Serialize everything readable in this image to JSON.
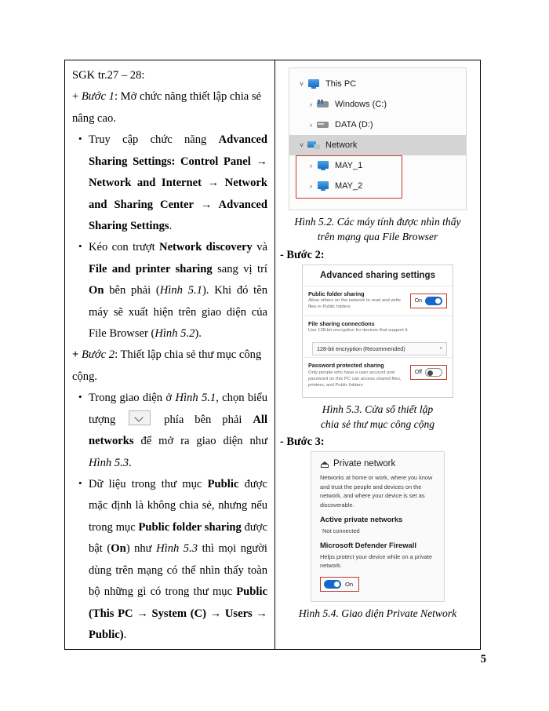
{
  "page": {
    "number": "5"
  },
  "left_column": {
    "source_ref": "SGK tr.27 – 28:",
    "step1_intro_prefix": "+ ",
    "step1_label": "Bước 1",
    "step1_text": ": Mở chức năng thiết lập chia sẻ nâng cao.",
    "bullets": [
      {
        "id": "bullet-advanced-sharing",
        "plain_1": "Truy cập chức năng ",
        "bold_1": "Advanced Sharing Settings: Control Panel → Network and Internet → Network and Sharing Center → Advanced Sharing Settings",
        "plain_2": "."
      },
      {
        "id": "bullet-network-discovery",
        "plain_1": "Kéo con trượt ",
        "bold_1": "Network discovery",
        "plain_2": " và ",
        "bold_2": "File and printer sharing",
        "plain_3": " sang vị trí ",
        "bold_3": "On",
        "plain_4": " bên phải (",
        "italic_1": "Hình 5.1",
        "plain_5": "). Khi đó tên máy sẽ xuất hiện trên giao diện của File Browser (",
        "italic_2": "Hình 5.2",
        "plain_6": ")."
      }
    ],
    "step2_intro_prefix": "+ ",
    "step2_label": "Bước 2",
    "step2_text": ": Thiết lập chia sẻ thư mục công cộng.",
    "bullets2": [
      {
        "id": "bullet-all-networks",
        "plain_1": "Trong giao diện ở ",
        "italic_1": "Hình 5.1",
        "plain_2": ", chọn biểu tượng ",
        "icon": "chevron-down-icon",
        "plain_3": " phía bên phải ",
        "bold_1": "All networks",
        "plain_4": " để mở ra giao diện như ",
        "italic_2": "Hình 5.3",
        "plain_5": "."
      },
      {
        "id": "bullet-public-folder",
        "plain_1": "Dữ liệu trong thư mục ",
        "bold_1": "Public",
        "plain_2": " được mặc định là không chia sẻ, nhưng nếu trong mục ",
        "bold_2": "Public folder sharing",
        "plain_3": " được bật (",
        "bold_3": "On",
        "plain_4": ") như ",
        "italic_1": "Hình 5.3",
        "plain_5": " thì mọi người dùng trên mạng có thể nhìn thấy toàn bộ những gì có trong thư mục ",
        "bold_4": "Public (This PC → System (C) → Users → Public)",
        "plain_6": "."
      }
    ]
  },
  "right_column": {
    "figure_52": {
      "caption_line1": "Hình 5.2. Các máy tính được nhìn thấy",
      "caption_line2": "trên mạng qua File Browser",
      "tree": [
        {
          "label": "This PC",
          "caret": "˅",
          "icon": "monitor-icon",
          "indent": 0,
          "selected": false
        },
        {
          "label": "Windows (C:)",
          "caret": "›",
          "icon": "drive-windows-icon",
          "indent": 1,
          "selected": false
        },
        {
          "label": "DATA (D:)",
          "caret": "›",
          "icon": "drive-icon",
          "indent": 1,
          "selected": false
        },
        {
          "label": "Network",
          "caret": "˅",
          "icon": "network-icon",
          "indent": 0,
          "selected": true
        },
        {
          "label": "MAY_1",
          "caret": "›",
          "icon": "monitor-icon",
          "indent": 1,
          "selected": false
        },
        {
          "label": "MAY_2",
          "caret": "›",
          "icon": "monitor-icon",
          "indent": 1,
          "selected": false
        }
      ],
      "highlight_color": "#c0392b"
    },
    "step2_heading": "- Bước 2:",
    "figure_53": {
      "caption_line1": "Hình 5.3. Cửa sổ thiết lập",
      "caption_line2": "chia sẻ thư mục công cộng",
      "panel_title": "Advanced sharing settings",
      "sections": [
        {
          "id": "public-folder-sharing",
          "heading": "Public folder sharing",
          "description": "Allow others on the network to  read and write files in Public folders",
          "toggle_label": "On",
          "toggle_state": "on"
        },
        {
          "id": "file-sharing-connections",
          "heading": "File sharing connections",
          "description": "Use 128-bit encryption for devices that support it",
          "select_value": "128-bit encryption (Recommended)"
        },
        {
          "id": "password-protected-sharing",
          "heading": "Password protected sharing",
          "description": "Only people who have a user account and password on this  PC can access shared files, printers, and Public folders",
          "toggle_label": "Off",
          "toggle_state": "off"
        }
      ]
    },
    "step3_heading": "- Bước 3:",
    "figure_54": {
      "caption_line1": "Hình 5.4. Giao diện Private Network",
      "panel_title": "Private network",
      "panel_icon": "home-network-icon",
      "description": "Networks at home or work, where you know and trust the people and devices on the network, and where your device is set as discoverable.",
      "section_active_title": "Active private networks",
      "section_active_value": "Not connected",
      "section_firewall_title": "Microsoft Defender Firewall",
      "section_firewall_desc": "Helps protect your device while on a private network.",
      "firewall_toggle_label": "On",
      "firewall_toggle_state": "on"
    }
  }
}
